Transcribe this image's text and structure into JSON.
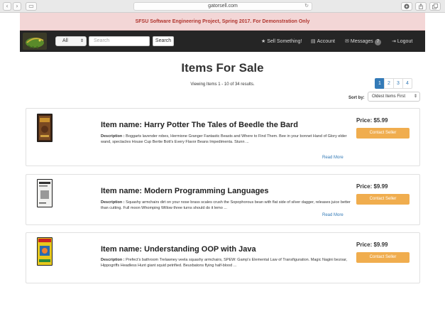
{
  "browser": {
    "url": "gatorsell.com",
    "back_glyph": "‹",
    "forward_glyph": "›",
    "sidebar_glyph": "▭",
    "reload_glyph": "↻"
  },
  "banner": {
    "text": "SFSU Software Engineering Project, Spring 2017. For Demonstration Only",
    "color": "#b0362f"
  },
  "navbar": {
    "category_selected": "All",
    "search_placeholder": "Search",
    "search_button": "Search",
    "sell_label": "Sell Something!",
    "account_label": "Account",
    "messages_label": "Messages",
    "messages_count": "7",
    "logout_label": "Logout",
    "sell_icon": "★",
    "account_icon": "▤",
    "messages_icon": "✉",
    "logout_icon": "⇥"
  },
  "page": {
    "title": "Items For Sale",
    "results_text": "Viewing Items 1 - 10 of 34 results.",
    "pages": [
      "1",
      "2",
      "3",
      "4"
    ],
    "current_page": "1",
    "sort_label": "Sort by:",
    "sort_selected": "Oldest Items First"
  },
  "items": [
    {
      "title": "Item name: Harry Potter The Tales of Beedle the Bard",
      "desc_label": "Description :",
      "description": "Boggarts lavender robes, Hermione Granger Fantastic Beasts and Where to Find Them. Bee in your bonnet Hand of Glory elder wand, spectacles House Cup Bertie Bott's Every Flavor Beans Impedimenta. Stunn ...",
      "read_more": "Read More",
      "price": "Price: $5.99",
      "contact": "Contact Seller"
    },
    {
      "title": "Item name: Modern Programming Languages",
      "desc_label": "Description :",
      "description": "Squashy armchairs dirt on your nose brass scales crush the Sopophorous bean with flat side of silver dagger, releases juice better than cutting. Full moon Whomping Willow three turns should do it lemo ...",
      "read_more": "Read More",
      "price": "Price: $9.99",
      "contact": "Contact Seller"
    },
    {
      "title": "Item name: Understanding OOP with Java",
      "desc_label": "Description :",
      "description": "Prefect's bathroom Trelawney veela squashy armchairs, SPEW: Gamp's Elemental Law of Transfiguration. Magic Nagini bezoar, Hippogriffs Headless Hunt giant squid petrified. Beuxbatons flying half-blood ...",
      "read_more": "",
      "price": "Price: $9.99",
      "contact": "Contact Seller"
    }
  ],
  "colors": {
    "accent": "#337ab7",
    "contact_button": "#f0ad4e",
    "navbar": "#252525",
    "banner_bg": "#f3d6d6"
  }
}
